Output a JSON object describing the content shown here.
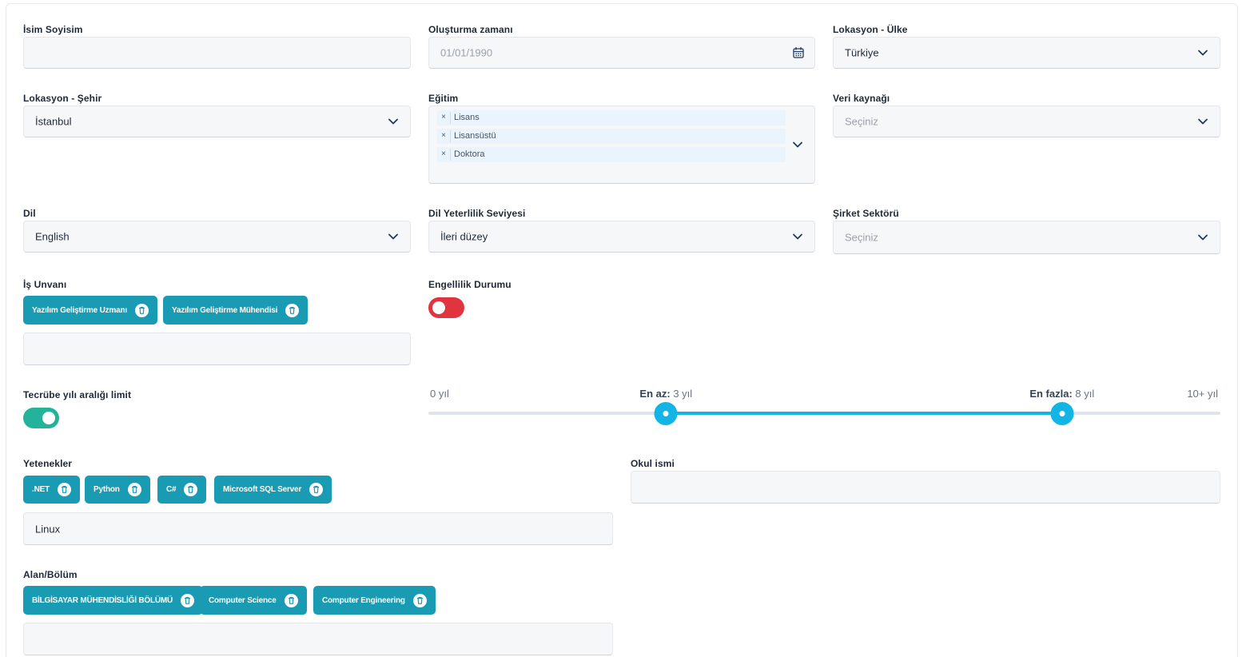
{
  "form": {
    "name": {
      "label": "İsim Soyisim",
      "value": ""
    },
    "created": {
      "label": "Oluşturma zamanı",
      "placeholder": "01/01/1990",
      "icon": "calendar-icon"
    },
    "country": {
      "label": "Lokasyon - Ülke",
      "value": "Türkiye"
    },
    "city": {
      "label": "Lokasyon - Şehir",
      "value": "İstanbul"
    },
    "education": {
      "label": "Eğitim",
      "tags": [
        "Lisans",
        "Lisansüstü",
        "Doktora"
      ],
      "remove_glyph": "×"
    },
    "source": {
      "label": "Veri kaynağı",
      "placeholder": "Seçiniz"
    },
    "language": {
      "label": "Dil",
      "value": "English"
    },
    "language_level": {
      "label": "Dil Yeterlilik Seviyesi",
      "value": "İleri düzey"
    },
    "sector": {
      "label": "Şirket Sektörü",
      "placeholder": "Seçiniz"
    },
    "job_title": {
      "label": "İş Unvanı",
      "chips": [
        "Yazılım Geliştirme Uzmanı",
        "Yazılım Geliştirme Mühendisi"
      ],
      "input_value": ""
    },
    "disability": {
      "label": "Engellilik Durumu",
      "on": false,
      "color": "#e0343f"
    },
    "experience": {
      "label": "Tecrübe yılı aralığı limit",
      "limit_on": true,
      "toggle_color": "#22b39a",
      "min_label": "0 yıl",
      "max_label": "10+ yıl",
      "low_prefix": "En az:",
      "low_value": "3 yıl",
      "high_prefix": "En fazla:",
      "high_value": "8 yıl",
      "range_min": 0,
      "range_max": 10,
      "low": 3,
      "high": 8,
      "accent": "#12b5e6"
    },
    "skills": {
      "label": "Yetenekler",
      "chips": [
        ".NET",
        "Python",
        "C#",
        "Microsoft SQL Server"
      ],
      "input_value": "Linux"
    },
    "school": {
      "label": "Okul ismi",
      "value": ""
    },
    "department": {
      "label": "Alan/Bölüm",
      "chips": [
        "BİLGİSAYAR MÜHENDİSLİĞİ BÖLÜMÜ",
        "Computer Science",
        "Computer Engineering"
      ],
      "input_value": ""
    }
  },
  "colors": {
    "chip": "#199bb3",
    "field_bg": "#f6f7f9",
    "chevron": "#1e3a5f"
  }
}
